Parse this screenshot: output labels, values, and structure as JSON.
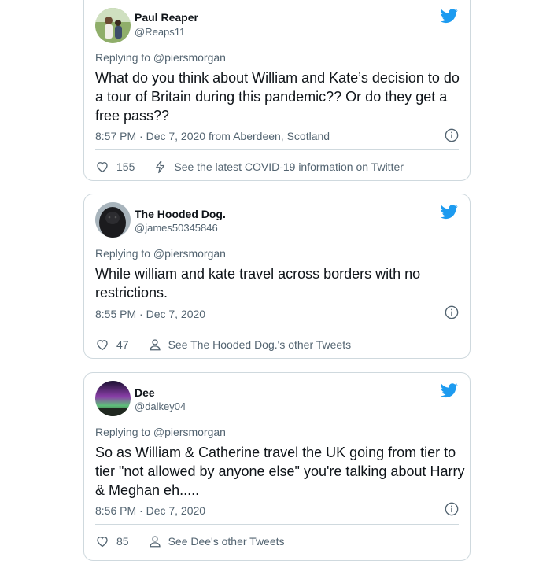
{
  "colors": {
    "accent": "#1d9bf0",
    "muted": "#536471",
    "text": "#0f1419",
    "border": "#cfd9de"
  },
  "tweets": [
    {
      "name": "Paul Reaper",
      "handle": "@Reaps11",
      "replying": "Replying to @piersmorgan",
      "text": "What do you think about William and Kate’s decision to do a tour of Britain during this pandemic?? Or do they get a free pass??",
      "meta": "8:57 PM · Dec 7, 2020 from Aberdeen, Scotland",
      "likes": "155",
      "action_icon": "lightning-icon",
      "action_text": "See the latest COVID-19 information on Twitter"
    },
    {
      "name": "The Hooded Dog.",
      "handle": "@james50345846",
      "replying": "Replying to @piersmorgan",
      "text": "While william and kate travel across borders with no restrictions.",
      "meta": "8:55 PM · Dec 7, 2020",
      "likes": "47",
      "action_icon": "person-icon",
      "action_text": "See The Hooded Dog.'s other Tweets"
    },
    {
      "name": "Dee",
      "handle": "@dalkey04",
      "replying": "Replying to @piersmorgan",
      "text": "So as William & Catherine travel the UK going from tier to tier \"not allowed by anyone else\" you're talking about Harry & Meghan eh.....",
      "meta": "8:56 PM · Dec 7, 2020",
      "likes": "85",
      "action_icon": "person-icon",
      "action_text": "See Dee's other Tweets"
    }
  ]
}
